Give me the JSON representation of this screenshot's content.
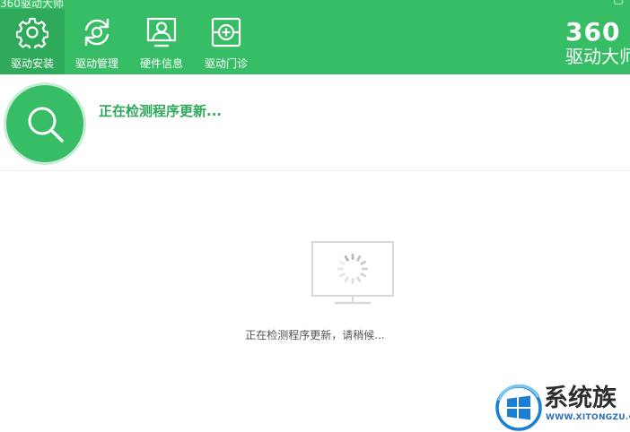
{
  "app": {
    "title": "360驱动大师"
  },
  "nav": {
    "items": [
      {
        "label": "驱动安装",
        "icon": "gear-icon",
        "active": true
      },
      {
        "label": "驱动管理",
        "icon": "refresh-icon",
        "active": false
      },
      {
        "label": "硬件信息",
        "icon": "monitor-user-icon",
        "active": false
      },
      {
        "label": "驱动门诊",
        "icon": "medical-kit-icon",
        "active": false
      }
    ]
  },
  "brand": {
    "number": "360",
    "name": "驱动大师"
  },
  "status": {
    "title": "正在检测程序更新..."
  },
  "main": {
    "message": "正在检测程序更新，请稍候..."
  },
  "watermark": {
    "text": "系统族",
    "url": "WWW.XITONGZU.COM"
  },
  "colors": {
    "header_green": "#37bd65",
    "active_tab": "#2fa95a",
    "status_text": "#2ea85a"
  }
}
